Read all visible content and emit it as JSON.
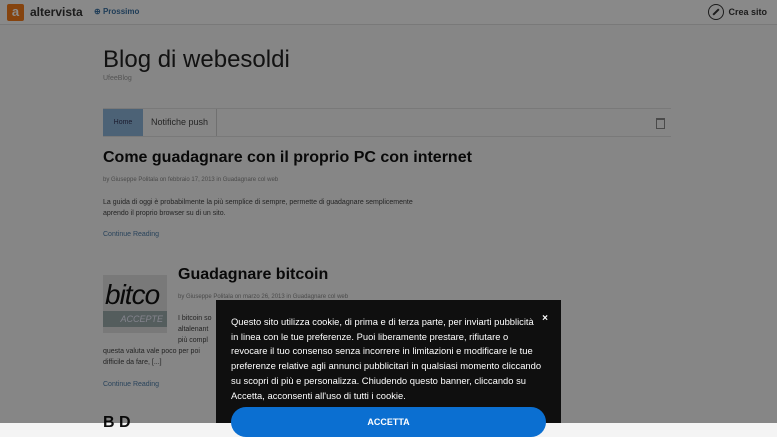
{
  "topbar": {
    "logo_letter": "a",
    "logo_text": "altervista",
    "next_label": "Prossimo",
    "create_site_label": "Crea sito"
  },
  "blog": {
    "title": "Blog di webesoldi",
    "subtitle": "UfeeBlog"
  },
  "nav": {
    "home_label": "Home",
    "push_label": "Notifiche push"
  },
  "posts": [
    {
      "title": "Come guadagnare con il proprio PC con internet",
      "meta": "by Giuseppe Politala on febbraio 17, 2013 in Guadagnare col web",
      "excerpt_lines": [
        "La guida di oggi è probabilmente la più semplice di sempre, permette di guadagnare semplicemente",
        "aprendo il proprio browser su di un sito."
      ],
      "continue_label": "Continue Reading"
    },
    {
      "title": "Guadagnare bitcoin",
      "meta": "by Giuseppe Politala on marzo 26, 2013 in Guadagnare col web",
      "excerpt_lines": [
        "I bitcoin so",
        "altalenant",
        "più compl",
        "questa valuta vale poco per poi",
        "difficile da fare, [...]"
      ],
      "continue_label": "Continue Reading",
      "thumb_top": "bitco",
      "thumb_bar": "ACCEPTE"
    }
  ],
  "next_post_stub": "B D",
  "cookie": {
    "text": "Questo sito utilizza cookie, di prima e di terza parte, per inviarti pubblicità in linea con le tue preferenze. Puoi liberamente prestare, rifiutare o revocare il tuo consenso senza incorrere in limitazioni e modificare le tue preferenze relative agli annunci pubblicitari in qualsiasi momento cliccando su scopri di più e personalizza. Chiudendo questo banner, cliccando su Accetta, acconsenti all'uso di tutti i cookie.",
    "close_label": "×",
    "accept_label": "ACCETTA"
  },
  "colors": {
    "accent": "#0b6fd1",
    "logo": "#f27a1a",
    "link": "#4a7aa6"
  }
}
